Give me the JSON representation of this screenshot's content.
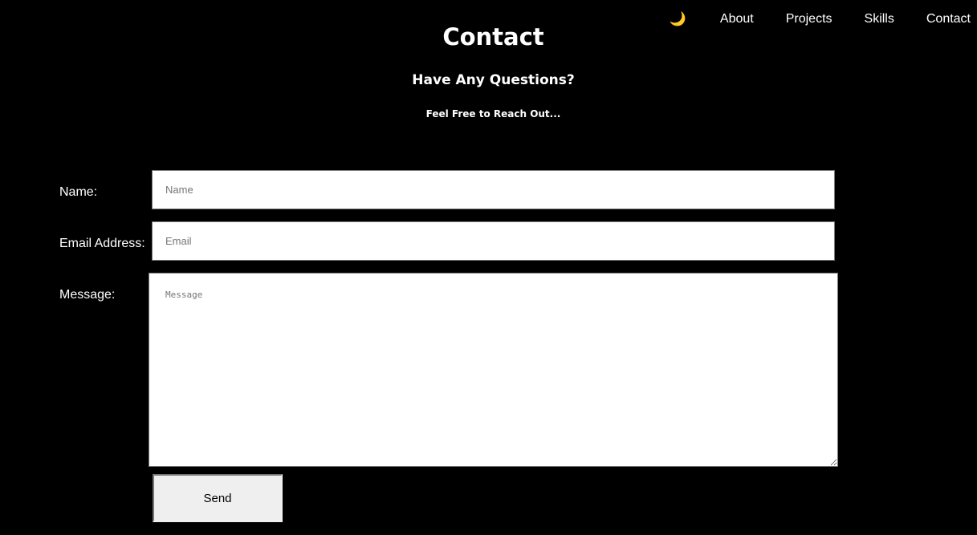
{
  "nav": {
    "theme_toggle_icon": "🌙",
    "theme_toggle_semantic": "moon-icon",
    "items": [
      {
        "label": "About"
      },
      {
        "label": "Projects"
      },
      {
        "label": "Skills"
      },
      {
        "label": "Contact"
      }
    ]
  },
  "header": {
    "title": "Contact",
    "subtitle": "Have Any Questions?",
    "tagline": "Feel Free to Reach Out..."
  },
  "form": {
    "name": {
      "label": "Name:",
      "placeholder": "Name",
      "value": ""
    },
    "email": {
      "label": "Email Address:",
      "placeholder": "Email",
      "value": ""
    },
    "message": {
      "label": "Message:",
      "placeholder": "Message",
      "value": ""
    },
    "submit_label": "Send"
  },
  "colors": {
    "background": "#000000",
    "text": "#ffffff",
    "moon": "#f0b43c",
    "button_bg": "#efefef"
  }
}
